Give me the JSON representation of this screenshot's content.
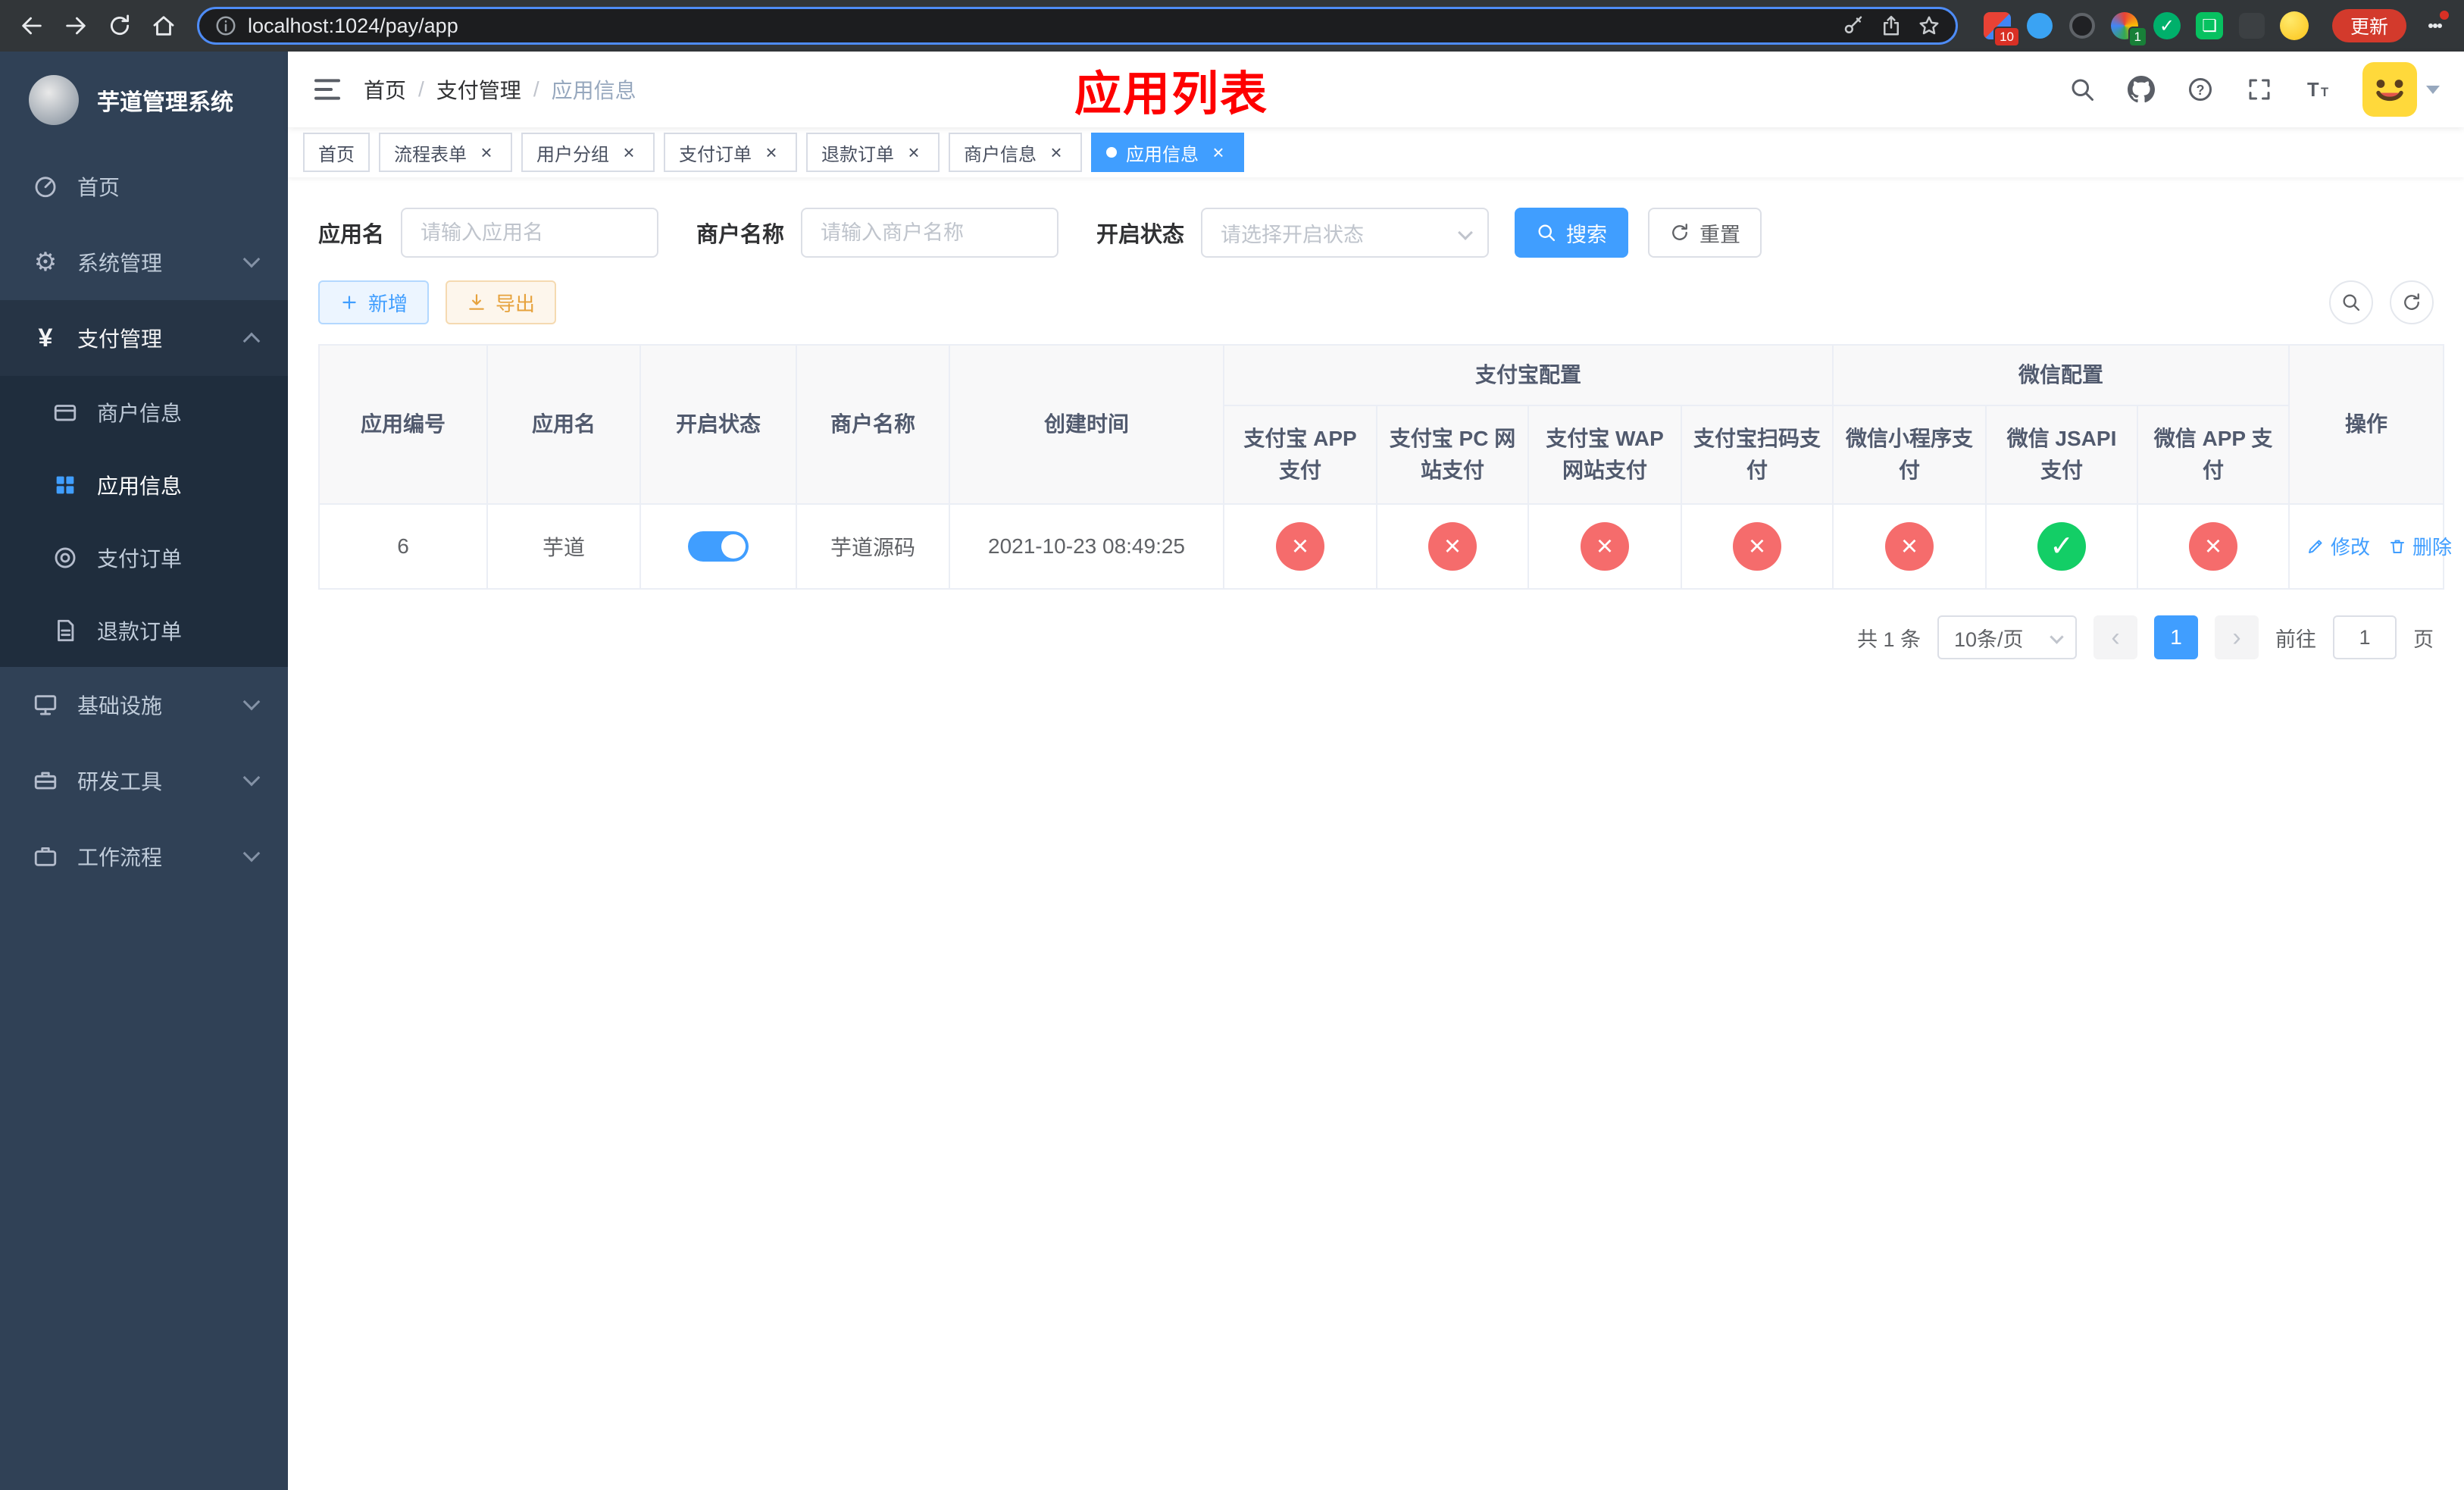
{
  "browser": {
    "url": "localhost:1024/pay/app",
    "update_button": "更新",
    "extension_badges": {
      "blocker": "10",
      "colorful": "1"
    }
  },
  "sidebar": {
    "title": "芋道管理系统",
    "items": [
      {
        "label": "首页"
      },
      {
        "label": "系统管理"
      },
      {
        "label": "支付管理"
      },
      {
        "label": "基础设施"
      },
      {
        "label": "研发工具"
      },
      {
        "label": "工作流程"
      }
    ],
    "payment_submenu": [
      {
        "label": "商户信息"
      },
      {
        "label": "应用信息"
      },
      {
        "label": "支付订单"
      },
      {
        "label": "退款订单"
      }
    ]
  },
  "header": {
    "breadcrumb": [
      "首页",
      "支付管理",
      "应用信息"
    ],
    "page_title": "应用列表"
  },
  "tabs": [
    {
      "label": "首页",
      "closable": false,
      "active": false
    },
    {
      "label": "流程表单",
      "closable": true,
      "active": false
    },
    {
      "label": "用户分组",
      "closable": true,
      "active": false
    },
    {
      "label": "支付订单",
      "closable": true,
      "active": false
    },
    {
      "label": "退款订单",
      "closable": true,
      "active": false
    },
    {
      "label": "商户信息",
      "closable": true,
      "active": false
    },
    {
      "label": "应用信息",
      "closable": true,
      "active": true
    }
  ],
  "filters": {
    "app_name_label": "应用名",
    "app_name_placeholder": "请输入应用名",
    "merchant_label": "商户名称",
    "merchant_placeholder": "请输入商户名称",
    "status_label": "开启状态",
    "status_placeholder": "请选择开启状态",
    "search_button": "搜索",
    "reset_button": "重置"
  },
  "toolbar": {
    "add_label": "新增",
    "export_label": "导出"
  },
  "table": {
    "alipay_group": "支付宝配置",
    "wechat_group": "微信配置",
    "col_id": "应用编号",
    "col_name": "应用名",
    "col_status": "开启状态",
    "col_merchant": "商户名称",
    "col_created": "创建时间",
    "col_actions": "操作",
    "sub_columns": [
      "支付宝 APP 支付",
      "支付宝 PC 网站支付",
      "支付宝 WAP 网站支付",
      "支付宝扫码支付",
      "微信小程序支付",
      "微信 JSAPI 支付",
      "微信 APP 支付"
    ],
    "rows": [
      {
        "id": "6",
        "name": "芋道",
        "status": "on",
        "merchant": "芋道源码",
        "created": "2021-10-23 08:49:25",
        "configs": [
          "fail",
          "fail",
          "fail",
          "fail",
          "fail",
          "ok",
          "fail"
        ],
        "edit_label": "修改",
        "delete_label": "删除"
      }
    ]
  },
  "pagination": {
    "total": "共 1 条",
    "page_size": "10条/页",
    "prev": "‹",
    "next": "›",
    "current_page": "1",
    "goto_label": "前往",
    "goto_value": "1",
    "goto_suffix": "页"
  },
  "colors": {
    "primary": "#409eff",
    "danger": "#f56c6c",
    "success": "#13ce66",
    "warning": "#e6a23c",
    "title_red": "#fe0000",
    "sidebar_bg": "#304156",
    "submenu_bg": "#1f2d3d"
  }
}
